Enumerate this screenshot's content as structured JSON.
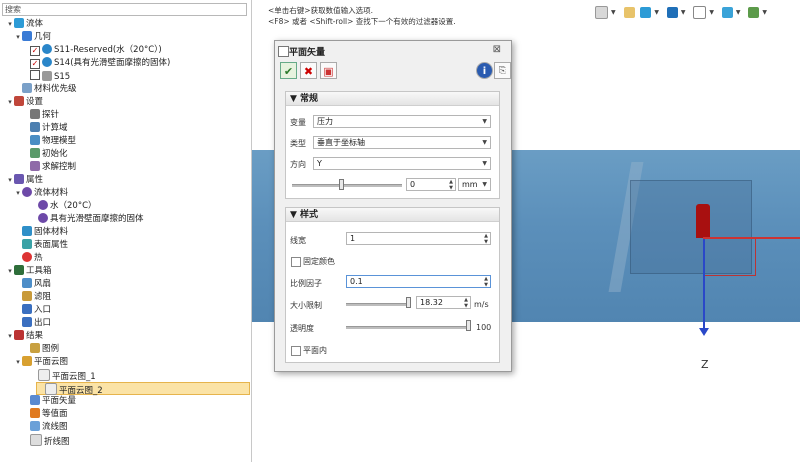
{
  "tree": {
    "search_placeholder": "搜索",
    "items": [
      {
        "label": "流体",
        "icon": "fluid-study-icon",
        "expanded": true
      },
      {
        "label": "几何",
        "icon": "geometry-icon",
        "expanded": true
      },
      {
        "label": "S11-Reserved(水（20°C）)",
        "icon": "sphere-body-icon",
        "checked": true
      },
      {
        "label": "S14(具有光滑壁面摩擦的固体)",
        "icon": "sphere-body-icon",
        "checked": true
      },
      {
        "label": "S15",
        "icon": "gray-body-icon",
        "checked": false
      },
      {
        "label": "材料优先级",
        "icon": "material-priority-icon"
      },
      {
        "label": "设置",
        "icon": "settings-icon",
        "expanded": true
      },
      {
        "label": "探针",
        "icon": "probe-icon"
      },
      {
        "label": "计算域",
        "icon": "domain-icon"
      },
      {
        "label": "物理模型",
        "icon": "physics-icon"
      },
      {
        "label": "初始化",
        "icon": "init-icon"
      },
      {
        "label": "求解控制",
        "icon": "solver-icon"
      },
      {
        "label": "属性",
        "icon": "properties-icon",
        "expanded": true
      },
      {
        "label": "流体材料",
        "icon": "fluid-material-icon",
        "expanded": true
      },
      {
        "label": "水（20°C）",
        "icon": "water-icon"
      },
      {
        "label": "具有光滑壁面摩擦的固体",
        "icon": "solid-icon"
      },
      {
        "label": "固体材料",
        "icon": "solid-material-icon"
      },
      {
        "label": "表面属性",
        "icon": "surface-icon"
      },
      {
        "label": "热",
        "icon": "heat-icon"
      },
      {
        "label": "工具箱",
        "icon": "toolbox-icon",
        "expanded": true
      },
      {
        "label": "风扇",
        "icon": "fan-icon"
      },
      {
        "label": "滤阻",
        "icon": "filter-icon"
      },
      {
        "label": "入口",
        "icon": "inlet-icon"
      },
      {
        "label": "出口",
        "icon": "outlet-icon"
      },
      {
        "label": "结果",
        "icon": "results-icon",
        "expanded": true
      },
      {
        "label": "图例",
        "icon": "legend-icon"
      },
      {
        "label": "平面云图",
        "icon": "contour-icon",
        "expanded": true
      },
      {
        "label": "平面云图_1",
        "icon": "contour-item-icon"
      },
      {
        "label": "平面云图_2",
        "icon": "contour-item-icon",
        "selected": true
      },
      {
        "label": "平面矢量",
        "icon": "vector-icon"
      },
      {
        "label": "等值面",
        "icon": "isosurface-icon"
      },
      {
        "label": "流线图",
        "icon": "streamline-icon"
      },
      {
        "label": "折线图",
        "icon": "linechart-icon"
      }
    ]
  },
  "instructions": {
    "line1": "<单击右键>获取数值输入选项.",
    "line2": "<F8> 或者 <Shift-roll> 查找下一个有效的过滤器设置."
  },
  "dialog": {
    "title": "平面矢量",
    "close": "⊠",
    "general": {
      "header": "▼ 常规",
      "variable_label": "变量",
      "variable_value": "压力",
      "type_label": "类型",
      "type_value": "垂直于坐标轴",
      "direction_label": "方向",
      "direction_value": "Y",
      "offset_value": "0",
      "offset_unit": "mm",
      "offset_slider_fraction": 0.45
    },
    "style": {
      "header": "▼ 样式",
      "line_width_label": "线宽",
      "line_width_value": "1",
      "fixed_color_label": "固定颜色",
      "scale_label": "比例因子",
      "scale_value": "0.1",
      "size_limit_label": "大小限制",
      "size_limit_value": "18.32",
      "size_limit_unit": "m/s",
      "size_limit_fraction": 1.0,
      "transparency_label": "透明度",
      "transparency_value": "100",
      "transparency_fraction": 1.0,
      "in_plane_label": "平面内"
    }
  },
  "viewport": {
    "axis_label": "Z"
  },
  "colors": {
    "viewport_blue": "#5b8fba",
    "selection": "#fbe3a6",
    "axis_red": "#c33333",
    "axis_blue": "#2a48c8"
  }
}
